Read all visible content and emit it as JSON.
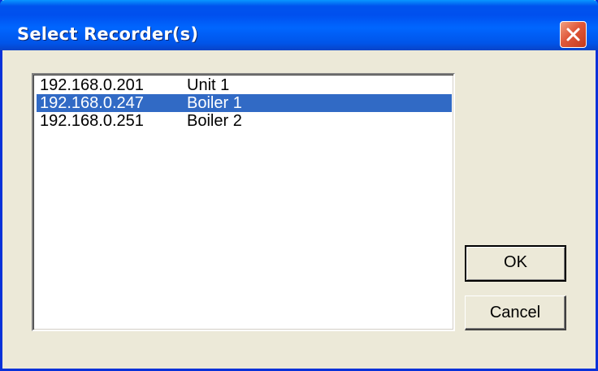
{
  "window": {
    "title": "Select Recorder(s)",
    "close_icon": "close-x-icon",
    "accent": "#0054e3",
    "close_color": "#e0583a"
  },
  "recorders": [
    {
      "ip": "192.168.0.201",
      "name": "Unit 1",
      "selected": false
    },
    {
      "ip": "192.168.0.247",
      "name": "Boiler 1",
      "selected": true
    },
    {
      "ip": "192.168.0.251",
      "name": "Boiler 2",
      "selected": false
    }
  ],
  "selection_color": "#316ac5",
  "buttons": {
    "ok_label": "OK",
    "cancel_label": "Cancel"
  }
}
